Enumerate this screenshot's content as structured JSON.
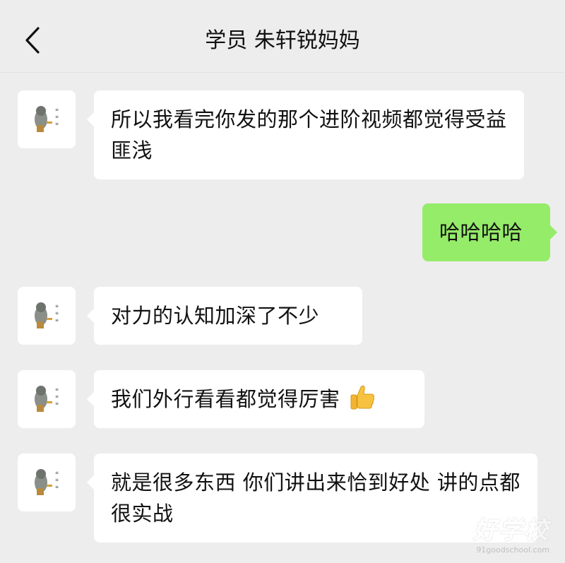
{
  "header": {
    "title": "学员 朱轩锐妈妈",
    "back_icon": "chevron-left-icon"
  },
  "messages": [
    {
      "side": "left",
      "text": "所以我看完你发的那个进阶视频都觉得受益匪浅"
    },
    {
      "side": "right",
      "text": "哈哈哈哈"
    },
    {
      "side": "left",
      "text": "对力的认知加深了不少"
    },
    {
      "side": "left",
      "text": "我们外行看看都觉得厉害",
      "emoji": "thumbs-up-icon"
    },
    {
      "side": "left",
      "text": "就是很多东西 你们讲出来恰到好处 讲的点都很实战"
    }
  ],
  "watermark": {
    "main": "好学校",
    "sub": "91goodschool.com"
  },
  "colors": {
    "background": "#ededed",
    "bubble_in": "#ffffff",
    "bubble_out": "#95ec69"
  }
}
